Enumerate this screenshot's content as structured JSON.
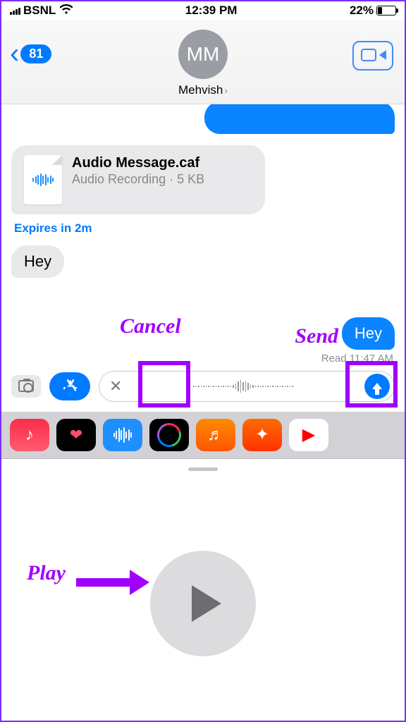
{
  "status": {
    "carrier": "BSNL",
    "time": "12:39 PM",
    "battery_pct": "22%"
  },
  "header": {
    "back_count": "81",
    "initials": "MM",
    "contact_name": "Mehvish"
  },
  "messages": {
    "audio_file": {
      "title": "Audio Message.caf",
      "subtitle": "Audio Recording · 5 KB"
    },
    "expires": "Expires in 2m",
    "incoming_text": "Hey",
    "outgoing_text": "Hey",
    "read_stamp": "Read 11:47 AM"
  },
  "annotations": {
    "cancel": "Cancel",
    "send": "Send",
    "play": "Play"
  }
}
